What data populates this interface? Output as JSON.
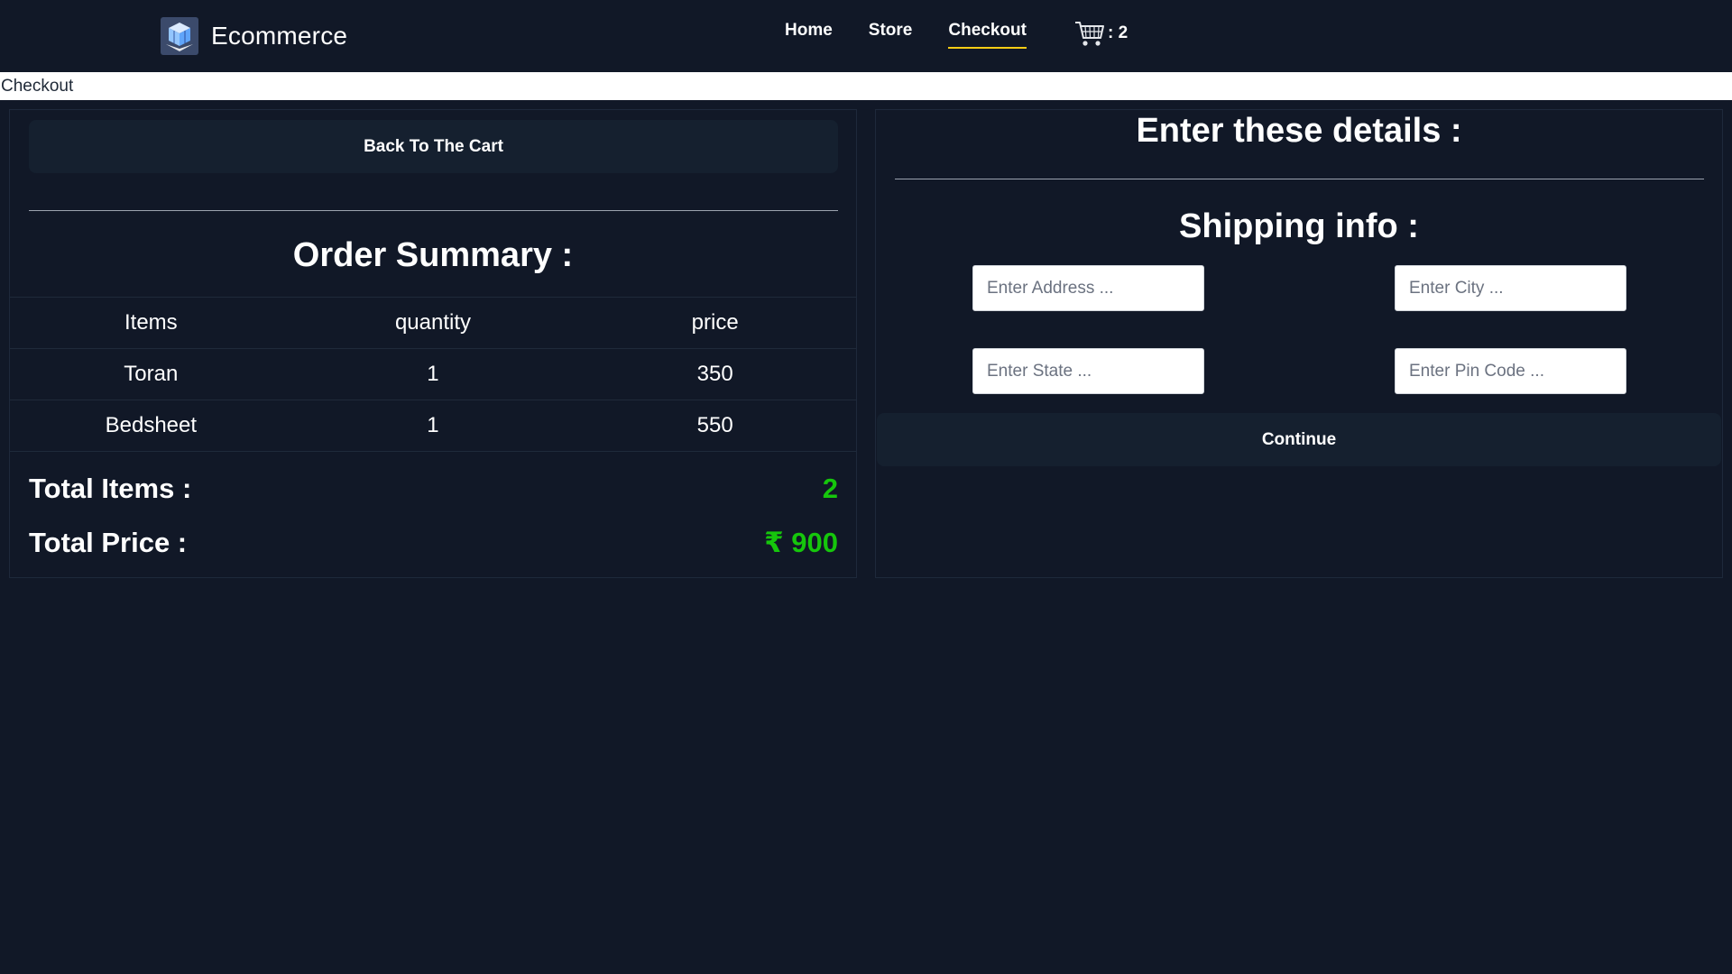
{
  "brand": {
    "name": "Ecommerce",
    "logo_icon": "cube-logo-icon"
  },
  "nav": {
    "links": [
      {
        "label": "Home"
      },
      {
        "label": "Store"
      },
      {
        "label": "Checkout",
        "active": true
      }
    ],
    "cart": {
      "icon": "shopping-cart-icon",
      "count_text": ": 2"
    },
    "active_underline_color": "#facc15"
  },
  "page_title": "Checkout",
  "order": {
    "back_button": "Back To The Cart",
    "heading": "Order Summary :",
    "columns": [
      "Items",
      "quantity",
      "price"
    ],
    "rows": [
      {
        "item": "Toran",
        "quantity": "1",
        "price": "350"
      },
      {
        "item": "Bedsheet",
        "quantity": "1",
        "price": "550"
      }
    ],
    "total_items_label": "Total Items :",
    "total_items_value": "2",
    "total_price_label": "Total Price :",
    "total_price_value": "₹ 900",
    "value_color": "#16c60c"
  },
  "details": {
    "heading": "Enter these details :",
    "shipping_heading": "Shipping info :",
    "address_placeholder": "Enter Address ...",
    "city_placeholder": "Enter City ...",
    "state_placeholder": "Enter State ...",
    "pincode_placeholder": "Enter Pin Code ...",
    "continue_button": "Continue"
  },
  "colors": {
    "background": "#111827",
    "button_bg": "#15202f"
  }
}
